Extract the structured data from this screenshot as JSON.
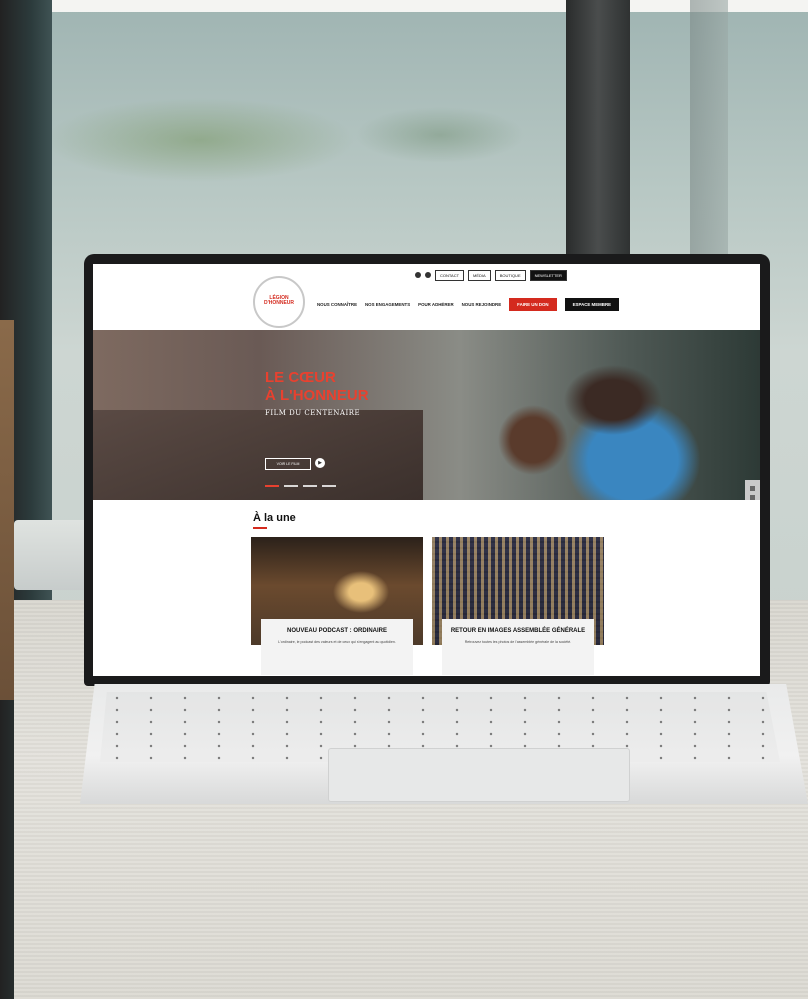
{
  "site": {
    "logo_text": "LÉGION D'HONNEUR",
    "topbar": {
      "buttons": [
        {
          "label": "CONTACT",
          "dark": false
        },
        {
          "label": "MÉDIA",
          "dark": false
        },
        {
          "label": "BOUTIQUE",
          "dark": false
        },
        {
          "label": "NEWSLETTER",
          "dark": true
        }
      ]
    },
    "nav": {
      "items": [
        "NOUS CONNAÎTRE",
        "NOS ENGAGEMENTS",
        "POUR ADHÉRER",
        "NOUS REJOINDRE"
      ],
      "donate_label": "FAIRE UN DON",
      "member_label": "ESPACE MEMBRE"
    },
    "hero": {
      "title_line1": "LE CŒUR",
      "title_line2": "À L'HONNEUR",
      "subtitle": "FILM DU CENTENAIRE",
      "button_label": "VOIR LE FILM"
    },
    "news": {
      "heading": "À la une",
      "cards": [
        {
          "headline": "NOUVEAU PODCAST : ORDINAIRE",
          "text": "L'ordinaire, le podcast des valeurs et de ceux qui s'engagent au quotidien."
        },
        {
          "headline": "RETOUR EN IMAGES ASSEMBLÉE GÉNÉRALE",
          "text": "Retrouvez toutes les photos de l'assemblée générale de la société."
        }
      ]
    }
  },
  "colors": {
    "accent": "#d42a1e",
    "dark": "#111111"
  },
  "icons": [
    "user-icon",
    "search-icon",
    "play-icon"
  ]
}
